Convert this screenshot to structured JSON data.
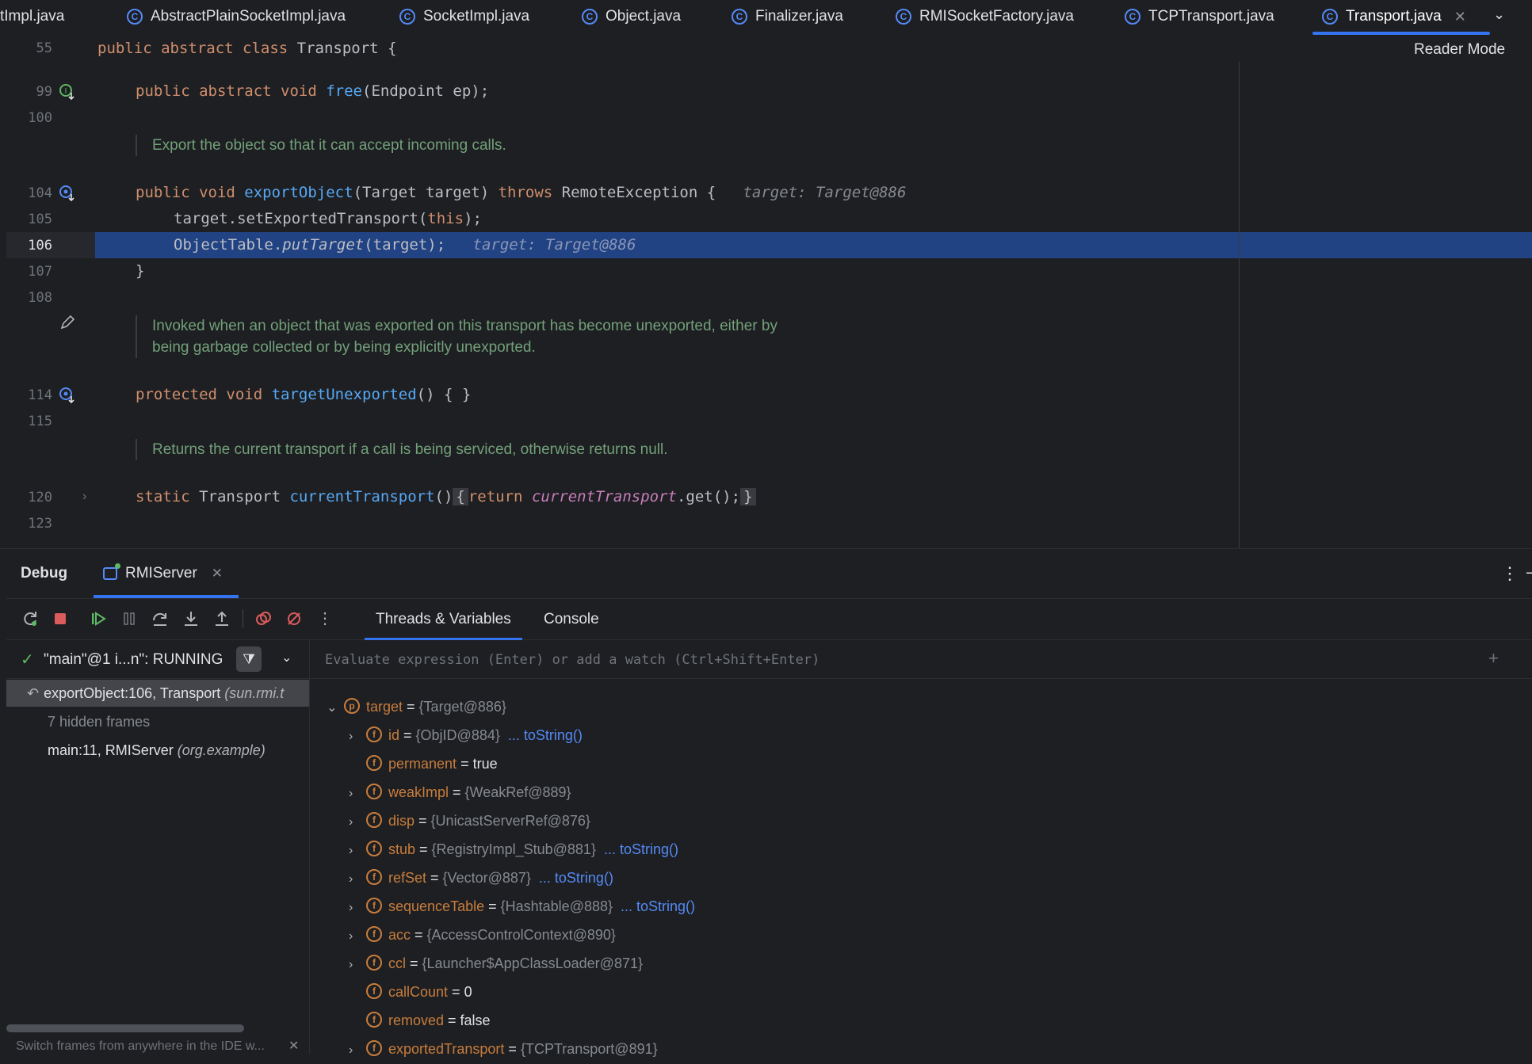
{
  "tabs": [
    {
      "label": "tImpl.java",
      "active": false,
      "icon": false
    },
    {
      "label": "AbstractPlainSocketImpl.java",
      "active": false,
      "icon": true
    },
    {
      "label": "SocketImpl.java",
      "active": false,
      "icon": true
    },
    {
      "label": "Object.java",
      "active": false,
      "icon": true
    },
    {
      "label": "Finalizer.java",
      "active": false,
      "icon": true
    },
    {
      "label": "RMISocketFactory.java",
      "active": false,
      "icon": true
    },
    {
      "label": "TCPTransport.java",
      "active": false,
      "icon": true
    },
    {
      "label": "Transport.java",
      "active": true,
      "icon": true
    }
  ],
  "editor": {
    "reader_mode": "Reader Mode",
    "line_numbers": [
      "55",
      "99",
      "100",
      "104",
      "105",
      "106",
      "107",
      "108",
      "114",
      "115",
      "120",
      "123"
    ],
    "class_decl": {
      "kw": "public abstract class",
      "name": "Transport",
      "rest": " {"
    },
    "free_line": {
      "kw": "public abstract void",
      "fn": "free",
      "rest": "(Endpoint ep);"
    },
    "doc1": "Export the object so that it can accept incoming calls.",
    "export_line": {
      "kw": "public void",
      "fn": "exportObject",
      "params": "(Target target) ",
      "throws": "throws",
      "rest": " RemoteException {",
      "hint": "target: Target@886"
    },
    "line105": {
      "pre": "target.setExportedTransport(",
      "kw": "this",
      "post": ");"
    },
    "line106": {
      "pre": "ObjectTable.",
      "fn": "putTarget",
      "post": "(target);",
      "hint": "target: Target@886"
    },
    "line107": "}",
    "doc2": [
      "Invoked when an object that was exported on this transport has become unexported, either by",
      "being garbage collected or by being explicitly unexported."
    ],
    "unexported_line": {
      "kw": "protected void",
      "fn": "targetUnexported",
      "rest": "() { }"
    },
    "doc3": "Returns the current transport if a call is being serviced, otherwise returns null.",
    "current_line": {
      "kw": "static",
      "type": " Transport ",
      "fn": "currentTransport",
      "rest": "()",
      "b1": "{",
      "ret": "return",
      "field": "currentTransport",
      "tail": ".get();",
      "b2": "}"
    }
  },
  "debug": {
    "title": "Debug",
    "session": "RMIServer",
    "tabs": [
      "Threads & Variables",
      "Console"
    ],
    "thread": "\"main\"@1 i...n\": RUNNING",
    "frames": [
      {
        "text": "exportObject:106, Transport",
        "pkg": "(sun.rmi.t"
      },
      {
        "text": "7 hidden frames",
        "pkg": ""
      },
      {
        "text": "main:11, RMIServer",
        "pkg": "(org.example)"
      }
    ],
    "watch_placeholder": "Evaluate expression (Enter) or add a watch (Ctrl+Shift+Enter)",
    "tip": "Switch frames from anywhere in the IDE w...",
    "variables": [
      {
        "name": "target",
        "eq": " = ",
        "type": "{Target@886}",
        "val": "",
        "link": "",
        "icon": "p",
        "chev": "open",
        "level": 0
      },
      {
        "name": "id",
        "eq": " = ",
        "type": "{ObjID@884}",
        "val": "",
        "link": "... toString()",
        "icon": "f",
        "chev": "closed",
        "level": 1
      },
      {
        "name": "permanent",
        "eq": " = ",
        "type": "",
        "val": "true",
        "link": "",
        "icon": "f",
        "chev": "none",
        "level": 1
      },
      {
        "name": "weakImpl",
        "eq": " = ",
        "type": "{WeakRef@889}",
        "val": "",
        "link": "",
        "icon": "f",
        "chev": "closed",
        "level": 1
      },
      {
        "name": "disp",
        "eq": " = ",
        "type": "{UnicastServerRef@876}",
        "val": "",
        "link": "",
        "icon": "f",
        "chev": "closed",
        "level": 1
      },
      {
        "name": "stub",
        "eq": " = ",
        "type": "{RegistryImpl_Stub@881}",
        "val": "",
        "link": "... toString()",
        "icon": "f",
        "chev": "closed",
        "level": 1
      },
      {
        "name": "refSet",
        "eq": " = ",
        "type": "{Vector@887}",
        "val": "",
        "link": "... toString()",
        "icon": "f",
        "chev": "closed",
        "level": 1
      },
      {
        "name": "sequenceTable",
        "eq": " = ",
        "type": "{Hashtable@888}",
        "val": "",
        "link": "... toString()",
        "icon": "f",
        "chev": "closed",
        "level": 1
      },
      {
        "name": "acc",
        "eq": " = ",
        "type": "{AccessControlContext@890}",
        "val": "",
        "link": "",
        "icon": "f",
        "chev": "closed",
        "level": 1
      },
      {
        "name": "ccl",
        "eq": " = ",
        "type": "{Launcher$AppClassLoader@871}",
        "val": "",
        "link": "",
        "icon": "f",
        "chev": "closed",
        "level": 1
      },
      {
        "name": "callCount",
        "eq": " = ",
        "type": "",
        "val": "0",
        "link": "",
        "icon": "f",
        "chev": "none",
        "level": 1
      },
      {
        "name": "removed",
        "eq": " = ",
        "type": "",
        "val": "false",
        "link": "",
        "icon": "f",
        "chev": "none",
        "level": 1
      },
      {
        "name": "exportedTransport",
        "eq": " = ",
        "type": "{TCPTransport@891}",
        "val": "",
        "link": "",
        "icon": "f",
        "chev": "closed",
        "level": 1
      }
    ]
  },
  "colors": {
    "accent": "#3574f0",
    "highlight": "#214283",
    "keyword": "#cf8e6d",
    "function": "#56a8f5",
    "doc": "#72a07a",
    "field": "#c77d3d"
  }
}
